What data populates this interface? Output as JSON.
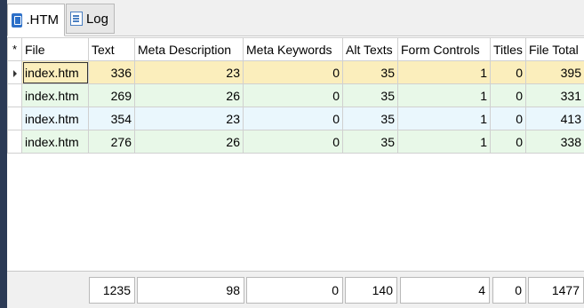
{
  "tabs": [
    {
      "label": ".HTM",
      "icon": "htm-file-icon"
    },
    {
      "label": "Log",
      "icon": "log-file-icon"
    }
  ],
  "grid": {
    "corner": "*",
    "columns": [
      "File",
      "Text",
      "Meta Description",
      "Meta Keywords",
      "Alt Texts",
      "Form Controls",
      "Titles",
      "File Total"
    ],
    "rows": [
      {
        "file": "index.htm",
        "text": "336",
        "meta_description": "23",
        "meta_keywords": "0",
        "alt_texts": "35",
        "form_controls": "1",
        "titles": "0",
        "file_total": "395"
      },
      {
        "file": "index.htm",
        "text": "269",
        "meta_description": "26",
        "meta_keywords": "0",
        "alt_texts": "35",
        "form_controls": "1",
        "titles": "0",
        "file_total": "331"
      },
      {
        "file": "index.htm",
        "text": "354",
        "meta_description": "23",
        "meta_keywords": "0",
        "alt_texts": "35",
        "form_controls": "1",
        "titles": "0",
        "file_total": "413"
      },
      {
        "file": "index.htm",
        "text": "276",
        "meta_description": "26",
        "meta_keywords": "0",
        "alt_texts": "35",
        "form_controls": "1",
        "titles": "0",
        "file_total": "338"
      }
    ]
  },
  "totals": {
    "text": "1235",
    "meta_description": "98",
    "meta_keywords": "0",
    "alt_texts": "140",
    "form_controls": "4",
    "titles": "0",
    "file_total": "1477"
  },
  "colors": {
    "selected_row": "#fbeebc",
    "alt_row_green": "#e8f8e8",
    "alt_row_blue": "#eaf7fd",
    "sidebar": "#2b3a55"
  }
}
